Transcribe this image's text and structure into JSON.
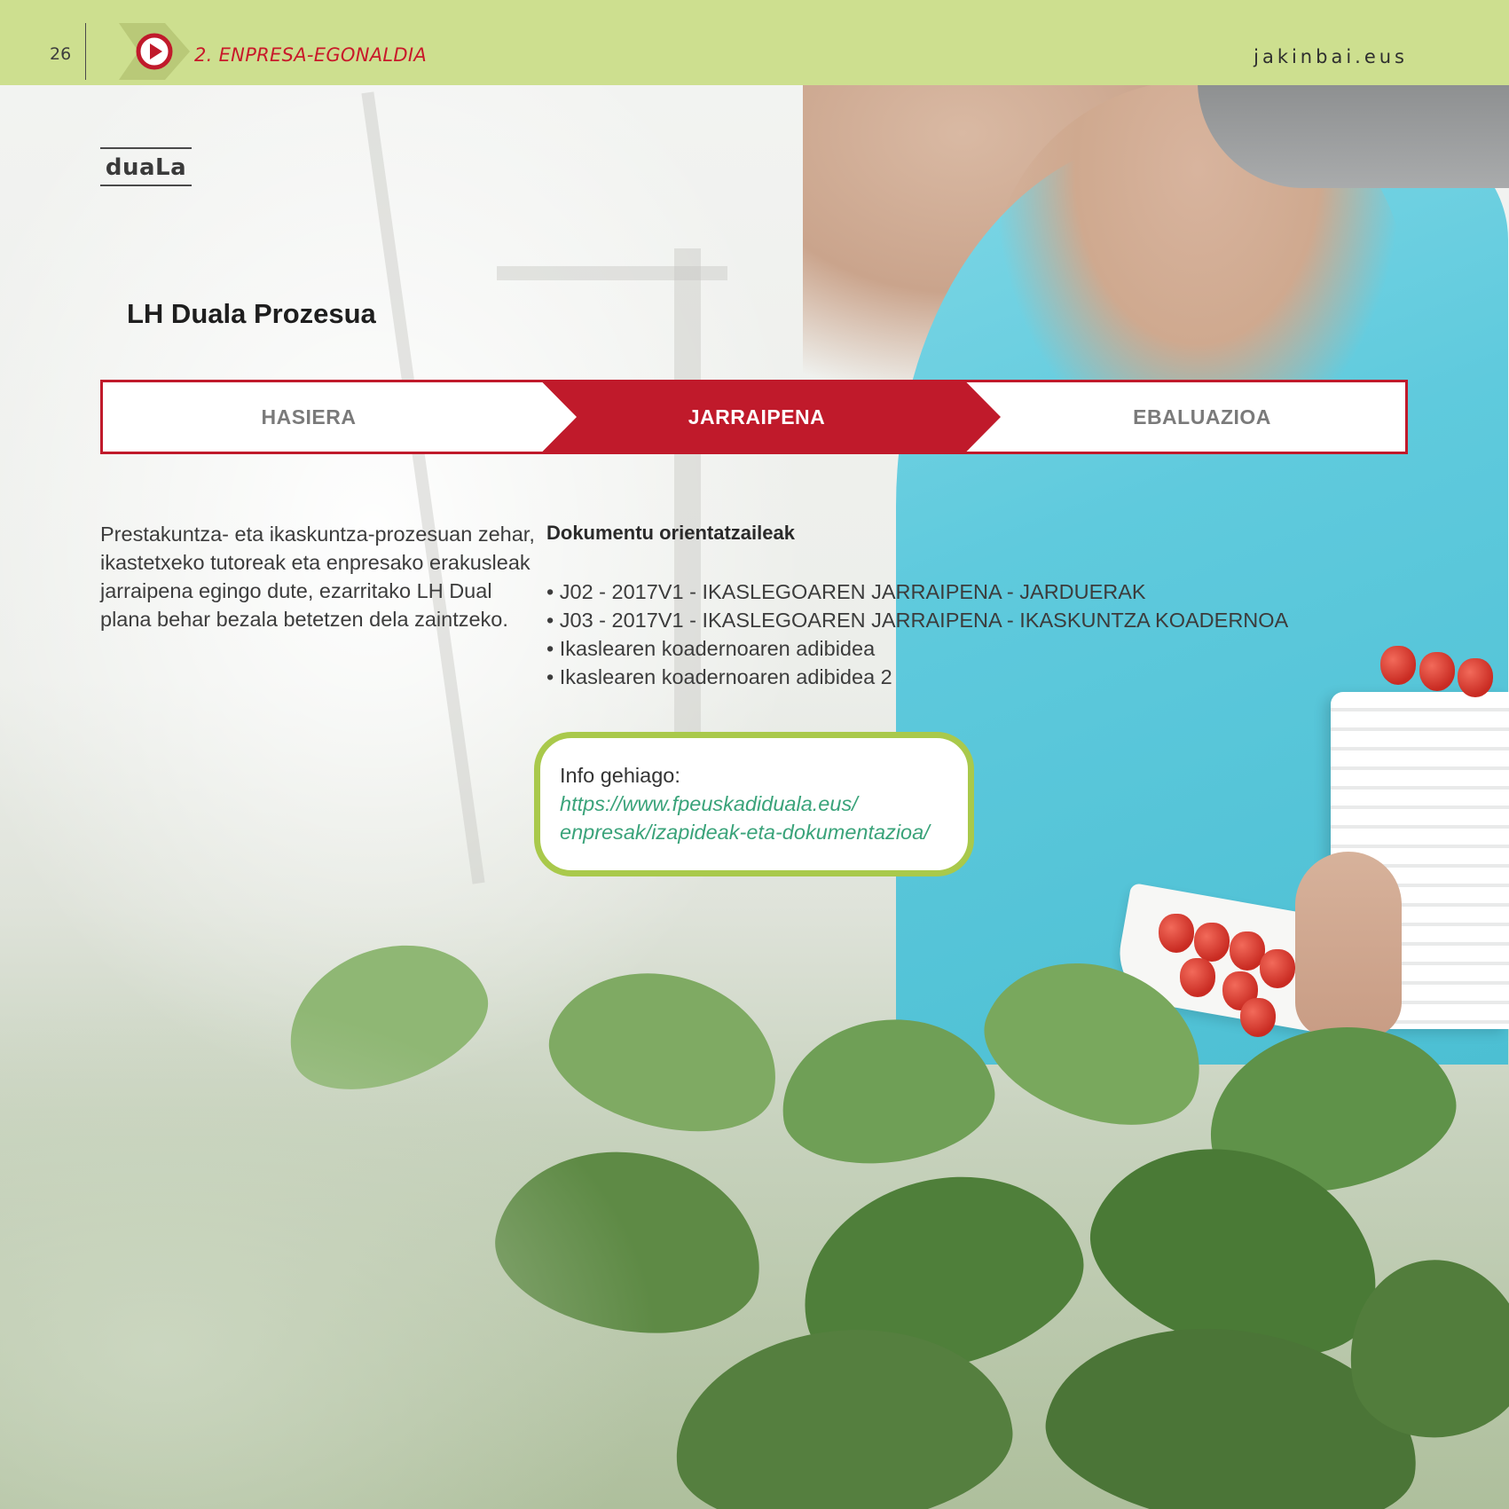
{
  "header": {
    "page_number": "26",
    "section_title": "2. ENPRESA-EGONALDIA",
    "site_url": "jakinbai.eus",
    "play_icon": "play-circle-icon"
  },
  "brand": {
    "label": "duaLa"
  },
  "heading": "LH Duala Prozesua",
  "process": {
    "steps": [
      {
        "label": "HASIERA",
        "active": false
      },
      {
        "label": "JARRAIPENA",
        "active": true
      },
      {
        "label": "EBALUAZIOA",
        "active": false
      }
    ],
    "active_color": "#c01a2b",
    "inactive_color": "#ffffff"
  },
  "intro_text": "Prestakuntza- eta ikaskuntza-prozesuan zehar, ikastetxeko tutoreak eta enpresako erakusleak jarraipena egingo dute, ezarritako LH Dual plana behar bezala betetzen dela zaintzeko.",
  "documents": {
    "title": "Dokumentu orientatzaileak",
    "items": [
      "J02 - 2017V1 - IKASLEGOAREN JARRAIPENA - JARDUERAK",
      "J03 - 2017V1 - IKASLEGOAREN JARRAIPENA - IKASKUNTZA KOADERNOA",
      "Ikaslearen koadernoaren adibidea",
      "Ikaslearen koadernoaren adibidea 2"
    ]
  },
  "info": {
    "label": "Info gehiago:",
    "link_line1": "https://www.fpeuskadiduala.eus/",
    "link_line2": "enpresak/izapideak-eta-dokumentazioa/"
  },
  "colors": {
    "header_bg": "#cddf8f",
    "accent_red": "#c01a2b",
    "info_border": "#a9c94b",
    "link_green": "#3aa37a"
  }
}
